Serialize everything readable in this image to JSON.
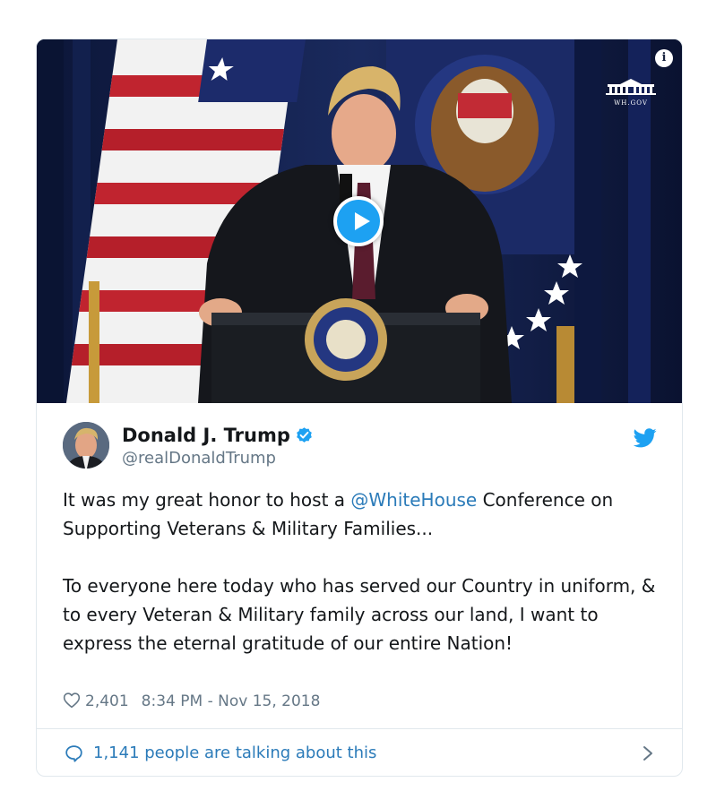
{
  "media": {
    "logo_text": "WH.GOV",
    "info_glyph": "i",
    "play_icon": "play-icon"
  },
  "author": {
    "display_name": "Donald J. Trump",
    "handle": "@realDonaldTrump",
    "verified": true
  },
  "tweet": {
    "line1_prefix": "It was my great honor to host a ",
    "mention": "@WhiteHouse",
    "line1_suffix": " Conference on Supporting Veterans & Military Families...",
    "paragraph2": "To everyone here today who has served our Country in uniform, & to every Veteran & Military family across our land, I want to express the eternal gratitude of our entire Nation!"
  },
  "meta": {
    "like_count": "2,401",
    "timestamp": "8:34 PM - Nov 15, 2018"
  },
  "conversation": {
    "label": "1,141 people are talking about this"
  },
  "colors": {
    "link": "#2b7bb9",
    "twitter_blue": "#1da1f2",
    "text": "#14171a",
    "muted": "#657786",
    "border": "#e1e8ed"
  }
}
